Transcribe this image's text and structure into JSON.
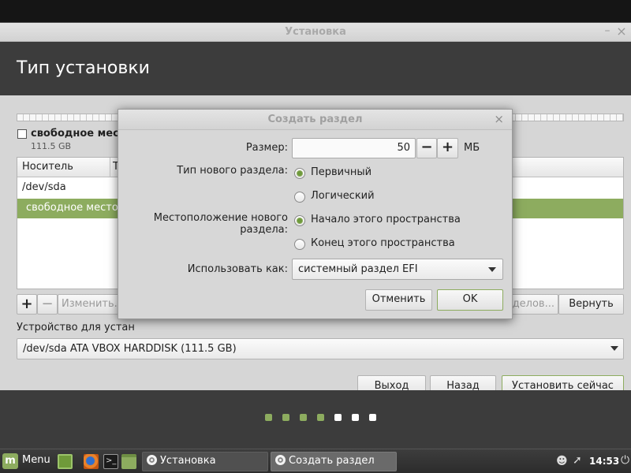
{
  "window": {
    "title": "Установка",
    "min_glyph": "–",
    "close_glyph": "×"
  },
  "banner": {
    "title": "Тип установки"
  },
  "partition_legend": {
    "label": "свободное место",
    "size": "111.5 GB"
  },
  "table": {
    "columns": [
      "Носитель",
      "Т"
    ],
    "rows": [
      {
        "device": "/dev/sda"
      },
      {
        "device": "свободное место",
        "selected": true
      }
    ]
  },
  "table_buttons": {
    "add": "+",
    "remove": "−",
    "change": "Изменить...",
    "new_table": "делов...",
    "revert": "Вернуть"
  },
  "bootloader": {
    "label": "Устройство для устан",
    "value": "/dev/sda ATA VBOX HARDDISK (111.5 GB)"
  },
  "nav": {
    "quit": "Выход",
    "back": "Назад",
    "install": "Установить сейчас"
  },
  "progress_dots": {
    "total": 7,
    "completed": 4,
    "done_color": "#8dac5f",
    "todo_color": "#ffffff"
  },
  "dialog": {
    "title": "Создать раздел",
    "close_glyph": "×",
    "size_label": "Размер:",
    "size_value": "50",
    "size_minus": "−",
    "size_plus": "+",
    "size_unit": "МБ",
    "type_label": "Тип нового раздела:",
    "type_options": [
      {
        "label": "Первичный",
        "selected": true
      },
      {
        "label": "Логический",
        "selected": false
      }
    ],
    "location_label": "Местоположение нового раздела:",
    "location_options": [
      {
        "label": "Начало этого пространства",
        "selected": true
      },
      {
        "label": "Конец этого пространства",
        "selected": false
      }
    ],
    "use_label": "Использовать как:",
    "use_value": "системный раздел EFI",
    "cancel": "Отменить",
    "ok": "OK"
  },
  "taskbar": {
    "menu_label": "Menu",
    "menu_logo": "m",
    "tasks": [
      {
        "label": "Установка"
      },
      {
        "label": "Создать раздел"
      }
    ],
    "clock": "14:53",
    "icons": [
      "mint-menu-icon",
      "show-desktop-icon",
      "firefox-icon",
      "terminal-icon",
      "files-icon",
      "user-icon",
      "network-icon",
      "power-icon"
    ]
  },
  "colors": {
    "accent": "#8dac5f",
    "banner": "#3c3c3c",
    "window_bg": "#d6d6d6"
  }
}
